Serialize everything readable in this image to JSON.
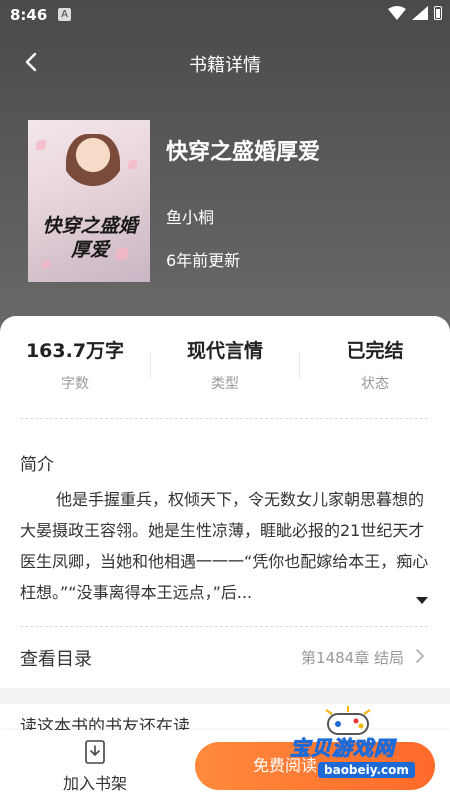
{
  "status_bar": {
    "time": "8:46",
    "notif_glyph": "A"
  },
  "nav": {
    "title": "书籍详情"
  },
  "book": {
    "title": "快穿之盛婚厚爱",
    "cover_text": "快穿之盛婚厚爱",
    "author": "鱼小桐",
    "updated": "6年前更新"
  },
  "stats": [
    {
      "value": "163.7万字",
      "label": "字数"
    },
    {
      "value": "现代言情",
      "label": "类型"
    },
    {
      "value": "已完结",
      "label": "状态"
    }
  ],
  "intro": {
    "heading": "简介",
    "text": "他是手握重兵，权倾天下，令无数女儿家朝思暮想的大晏摄政王容翎。她是生性凉薄，睚眦必报的21世纪天才医生凤卿，当她和他相遇一一一“凭你也配嫁给本王，痴心枉想。”“没事离得本王远点，”后..."
  },
  "catalog": {
    "label": "查看目录",
    "status": "第1484章 结局"
  },
  "readers": {
    "title": "读这本书的书友还在读"
  },
  "bottom": {
    "shelf_label": "加入书架",
    "read_label": "免费阅读"
  },
  "watermark": {
    "text": "宝贝游戏网",
    "url": "baobeiy.com"
  },
  "colors": {
    "accent": "#ff7a30",
    "hero": "#555555",
    "watermark": "#1e6bd8"
  }
}
